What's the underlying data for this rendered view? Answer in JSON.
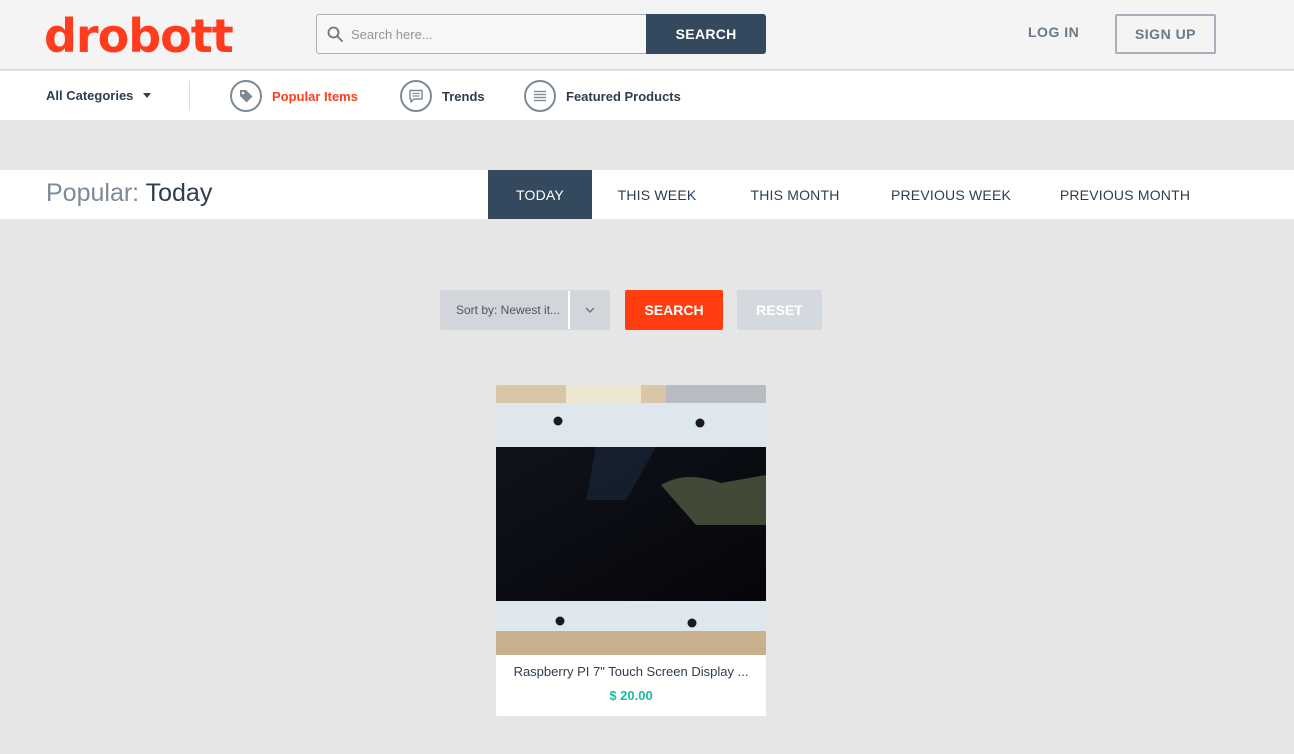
{
  "header": {
    "logo_text": "drobott",
    "search_placeholder": "Search here...",
    "search_button": "SEARCH",
    "login": "LOG IN",
    "signup": "SIGN UP"
  },
  "nav": {
    "categories": "All Categories",
    "items": [
      {
        "label": "Popular Items",
        "icon": "tag-icon",
        "active": true
      },
      {
        "label": "Trends",
        "icon": "chat-bubble-icon",
        "active": false
      },
      {
        "label": "Featured Products",
        "icon": "list-icon",
        "active": false
      }
    ]
  },
  "popular": {
    "label": "Popular:",
    "period": "Today",
    "tabs": [
      "TODAY",
      "THIS WEEK",
      "THIS MONTH",
      "PREVIOUS WEEK",
      "PREVIOUS MONTH"
    ],
    "active_tab": "TODAY"
  },
  "filters": {
    "sort_label": "Sort by: Newest it...",
    "search_button": "SEARCH",
    "reset_button": "RESET"
  },
  "products": [
    {
      "name": "Raspberry PI 7\" Touch Screen Display ...",
      "price": "$ 20.00"
    }
  ],
  "colors": {
    "brand": "#ff3c1e",
    "navy": "#34495e",
    "price": "#1abc9c",
    "background": "#e6e6e6"
  }
}
